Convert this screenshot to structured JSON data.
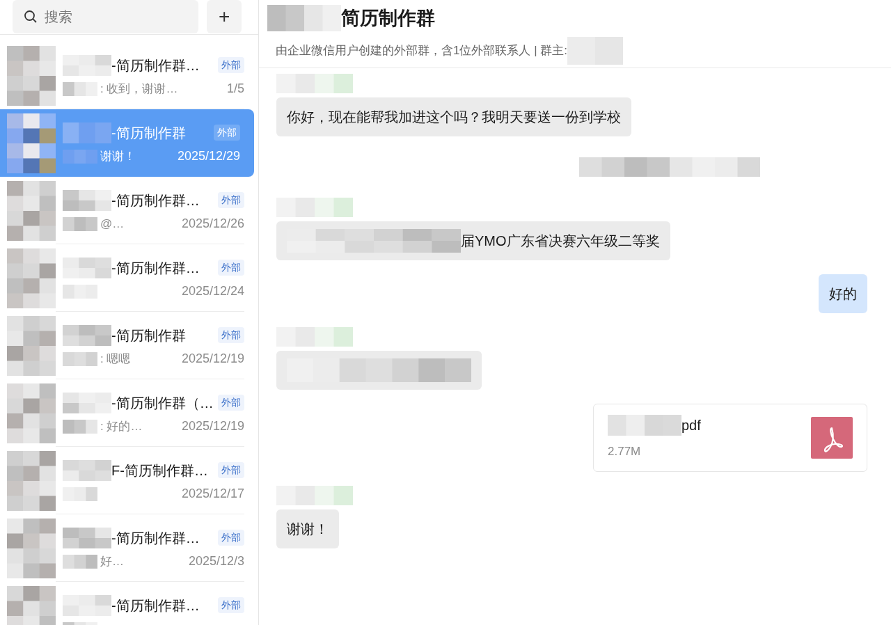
{
  "search": {
    "placeholder": "搜索",
    "add_button": "+"
  },
  "conversations": [
    {
      "name": "-简历制作群…",
      "tag": "外部",
      "preview": ": 收到，谢谢…",
      "date": "1/5",
      "selected": false
    },
    {
      "name": "-简历制作群",
      "tag": "外部",
      "preview": "谢谢！",
      "date": "2025/12/29",
      "selected": true
    },
    {
      "name": "-简历制作群…",
      "tag": "外部",
      "preview": "@…",
      "date": "2025/12/26",
      "selected": false
    },
    {
      "name": "-简历制作群…",
      "tag": "外部",
      "date": "2025/12/24",
      "selected": false
    },
    {
      "name": "-简历制作群",
      "tag": "外部",
      "preview": ": 嗯嗯",
      "date": "2025/12/19",
      "selected": false
    },
    {
      "name": "-简历制作群（…",
      "tag": "外部",
      "preview": ": 好的…",
      "date": "2025/12/19",
      "selected": false
    },
    {
      "name": "F-简历制作群…",
      "tag": "外部",
      "date": "2025/12/17",
      "selected": false
    },
    {
      "name": "-简历制作群…",
      "tag": "外部",
      "preview": "好…",
      "date": "2025/12/3",
      "selected": false
    },
    {
      "name": "-简历制作群…",
      "tag": "外部",
      "selected": false
    }
  ],
  "chat": {
    "title": "简历制作群",
    "subtitle": "由企业微信用户创建的外部群，含1位外部联系人 | 群主:",
    "messages": [
      {
        "kind": "text",
        "outgoing": false,
        "sender": true,
        "redacted": false,
        "text": "你好，现在能帮我加进这个吗？我明天要送一份到学校"
      },
      {
        "kind": "timestamp"
      },
      {
        "kind": "text",
        "outgoing": false,
        "sender": true,
        "redacted": true,
        "text": "届YMO广东省决赛六年级二等奖"
      },
      {
        "kind": "text",
        "outgoing": true,
        "redacted": false,
        "text": "好的"
      },
      {
        "kind": "text",
        "outgoing": false,
        "sender": true,
        "redacted": true
      },
      {
        "kind": "file",
        "name": "pdf",
        "size": "2.77M"
      },
      {
        "kind": "text",
        "outgoing": false,
        "sender": true,
        "redacted": false,
        "text": "谢谢！"
      }
    ]
  }
}
